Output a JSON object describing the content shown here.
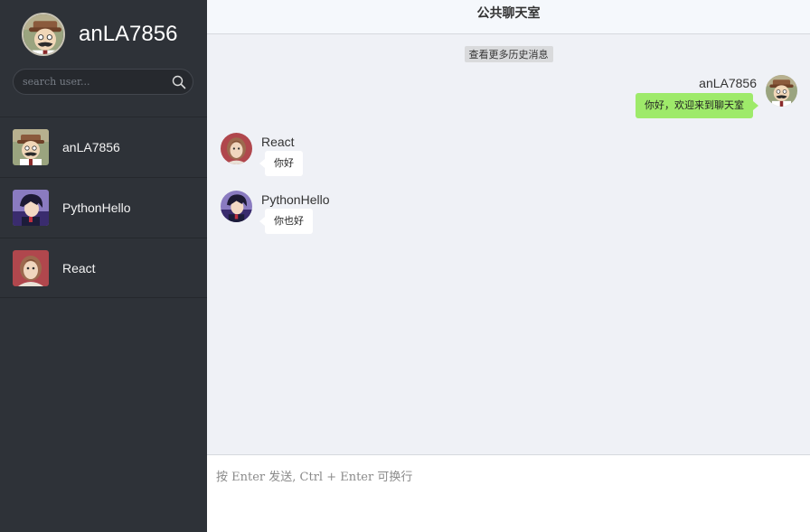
{
  "current_user": {
    "name": "anLA7856",
    "avatar": "detective-avatar"
  },
  "search": {
    "placeholder": "search user...",
    "icon": "search-icon"
  },
  "users": [
    {
      "name": "anLA7856",
      "avatar": "detective-avatar"
    },
    {
      "name": "PythonHello",
      "avatar": "kaito-avatar"
    },
    {
      "name": "React",
      "avatar": "red-haired-avatar"
    }
  ],
  "chat": {
    "title": "公共聊天室",
    "history_button": "查看更多历史消息",
    "messages": [
      {
        "sender": "anLA7856",
        "text": "你好，欢迎来到聊天室",
        "self": true,
        "avatar": "detective-avatar"
      },
      {
        "sender": "React",
        "text": "你好",
        "self": false,
        "avatar": "red-haired-avatar"
      },
      {
        "sender": "PythonHello",
        "text": "你也好",
        "self": false,
        "avatar": "kaito-avatar"
      }
    ],
    "composer_placeholder": "按 Enter 发送, Ctrl + Enter 可换行"
  },
  "colors": {
    "sidebar_bg": "#2e3238",
    "chat_bg": "#eff1f6",
    "self_bubble": "#9eea6a",
    "other_bubble": "#ffffff"
  }
}
